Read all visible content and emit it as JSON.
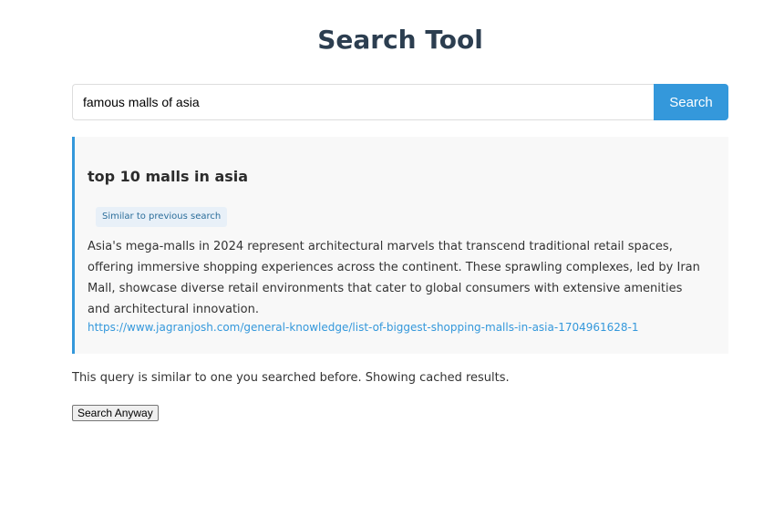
{
  "header": {
    "title": "Search Tool"
  },
  "search": {
    "value": "famous malls of asia",
    "button_label": "Search"
  },
  "result": {
    "title": "top 10 malls in asia",
    "badge": "Similar to previous search",
    "snippet": "Asia's mega-malls in 2024 represent architectural marvels that transcend traditional retail spaces, offering immersive shopping experiences across the continent. These sprawling complexes, led by Iran Mall, showcase diverse retail environments that cater to global consumers with extensive amenities and architectural innovation.",
    "url": "https://www.jagranjosh.com/general-knowledge/list-of-biggest-shopping-malls-in-asia-1704961628-1"
  },
  "cache_notice": {
    "message": "This query is similar to one you searched before. Showing cached results.",
    "button_label": "Search Anyway"
  },
  "colors": {
    "accent": "#3498db",
    "title": "#2c3e50",
    "card_background": "#f8f8f8"
  }
}
